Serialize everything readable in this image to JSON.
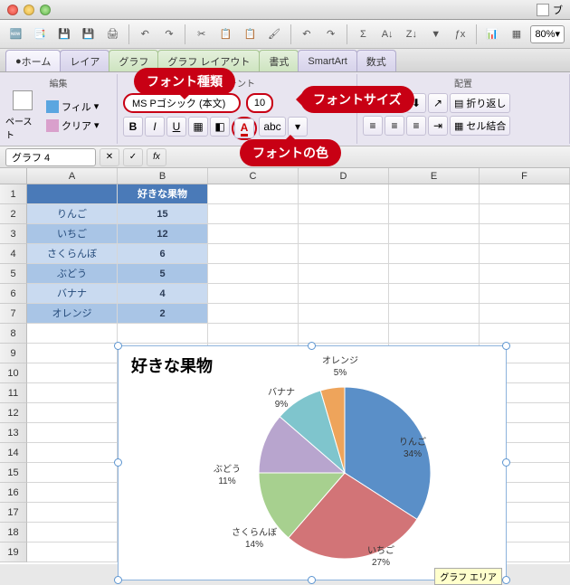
{
  "titlebar": {
    "title": "ブ"
  },
  "zoom": "80%",
  "tabs": {
    "home": "ホーム",
    "layout": "レイア",
    "graph": "グラフ",
    "graphlayout": "グラフ レイアウト",
    "format": "書式",
    "smartart": "SmartArt",
    "formula": "数式"
  },
  "ribbon": {
    "edit_label": "編集",
    "font_label": "フォント",
    "align_label": "配置",
    "paste": "ペースト",
    "fill": "フィル",
    "clear": "クリア",
    "fontname": "MS Pゴシック (本文)",
    "fontsize": "10",
    "wrap": "折り返し",
    "merge": "セル結合",
    "bold": "B",
    "italic": "I",
    "underline": "U",
    "abc": "abc",
    "fontcolor": "A"
  },
  "balloons": {
    "font_type": "フォント種類",
    "font_size": "フォントサイズ",
    "font_color": "フォントの色"
  },
  "namebox": "グラフ 4",
  "fx": "fx",
  "columns": [
    "A",
    "B",
    "C",
    "D",
    "E",
    "F"
  ],
  "rows": [
    "1",
    "2",
    "3",
    "4",
    "5",
    "6",
    "7",
    "8",
    "9",
    "10",
    "11",
    "12",
    "13",
    "14",
    "15",
    "16",
    "17",
    "18",
    "19"
  ],
  "table": {
    "header_b": "好きな果物",
    "rows": [
      {
        "label": "りんご",
        "value": "15"
      },
      {
        "label": "いちご",
        "value": "12"
      },
      {
        "label": "さくらんぼ",
        "value": "6"
      },
      {
        "label": "ぶどう",
        "value": "5"
      },
      {
        "label": "バナナ",
        "value": "4"
      },
      {
        "label": "オレンジ",
        "value": "2"
      }
    ]
  },
  "chart_data": {
    "type": "pie",
    "title": "好きな果物",
    "series": [
      {
        "name": "りんご",
        "value": 15,
        "pct": "34%",
        "color": "#5a8fc8"
      },
      {
        "name": "いちご",
        "value": 12,
        "pct": "27%",
        "color": "#d27477"
      },
      {
        "name": "さくらんぼ",
        "value": 6,
        "pct": "14%",
        "color": "#a7d08f"
      },
      {
        "name": "ぶどう",
        "value": 5,
        "pct": "11%",
        "color": "#b8a5ce"
      },
      {
        "name": "バナナ",
        "value": 4,
        "pct": "9%",
        "color": "#7fc5cd"
      },
      {
        "name": "オレンジ",
        "value": 2,
        "pct": "5%",
        "color": "#eea45b"
      }
    ]
  },
  "tooltip": "グラフ エリア"
}
